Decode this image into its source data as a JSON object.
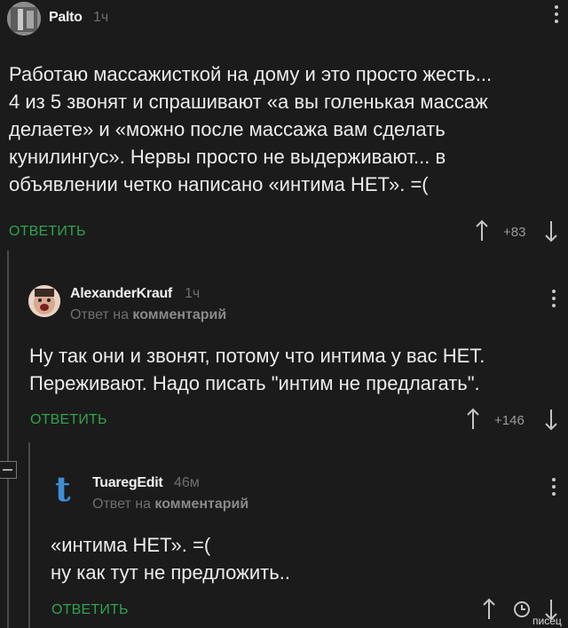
{
  "comments": [
    {
      "username": "Palto",
      "time": "1ч",
      "reply_to": null,
      "text": "Работаю массажисткой на дому и это просто жесть...\n4 из 5 звонят и спрашивают «а вы голенькая массаж\nделаете» и «можно после массажа вам сделать\nкунилингус». Нервы просто не выдерживают... в\nобъявлении четко написано «интима НЕТ». =(",
      "reply_label": "ОТВЕТИТЬ",
      "score": "+83"
    },
    {
      "username": "AlexanderKrauf",
      "time": "1ч",
      "reply_to_prefix": "Ответ на",
      "reply_to_link": "комментарий",
      "text": "Ну так они и звонят, потому что интима у вас НЕТ.\nПереживают. Надо писать \"интим не предлагать\".",
      "reply_label": "ОТВЕТИТЬ",
      "score": "+146"
    },
    {
      "username": "TuaregEdit",
      "time": "46м",
      "avatar_letter": "t",
      "reply_to_prefix": "Ответ на",
      "reply_to_link": "комментарий",
      "text": "«интима НЕТ». =(\nну как тут не предложить..",
      "reply_label": "ОТВЕТИТЬ",
      "score": null
    }
  ],
  "watermark": "писец",
  "colors": {
    "background": "#1b1b1b",
    "reply": "#2fa34d",
    "text": "#ececec",
    "muted": "#6f6f6f"
  },
  "icons": [
    "avatar",
    "upvote-arrow-icon",
    "downvote-arrow-icon",
    "more-dots-icon",
    "clock-icon",
    "collapse-minus-icon"
  ]
}
